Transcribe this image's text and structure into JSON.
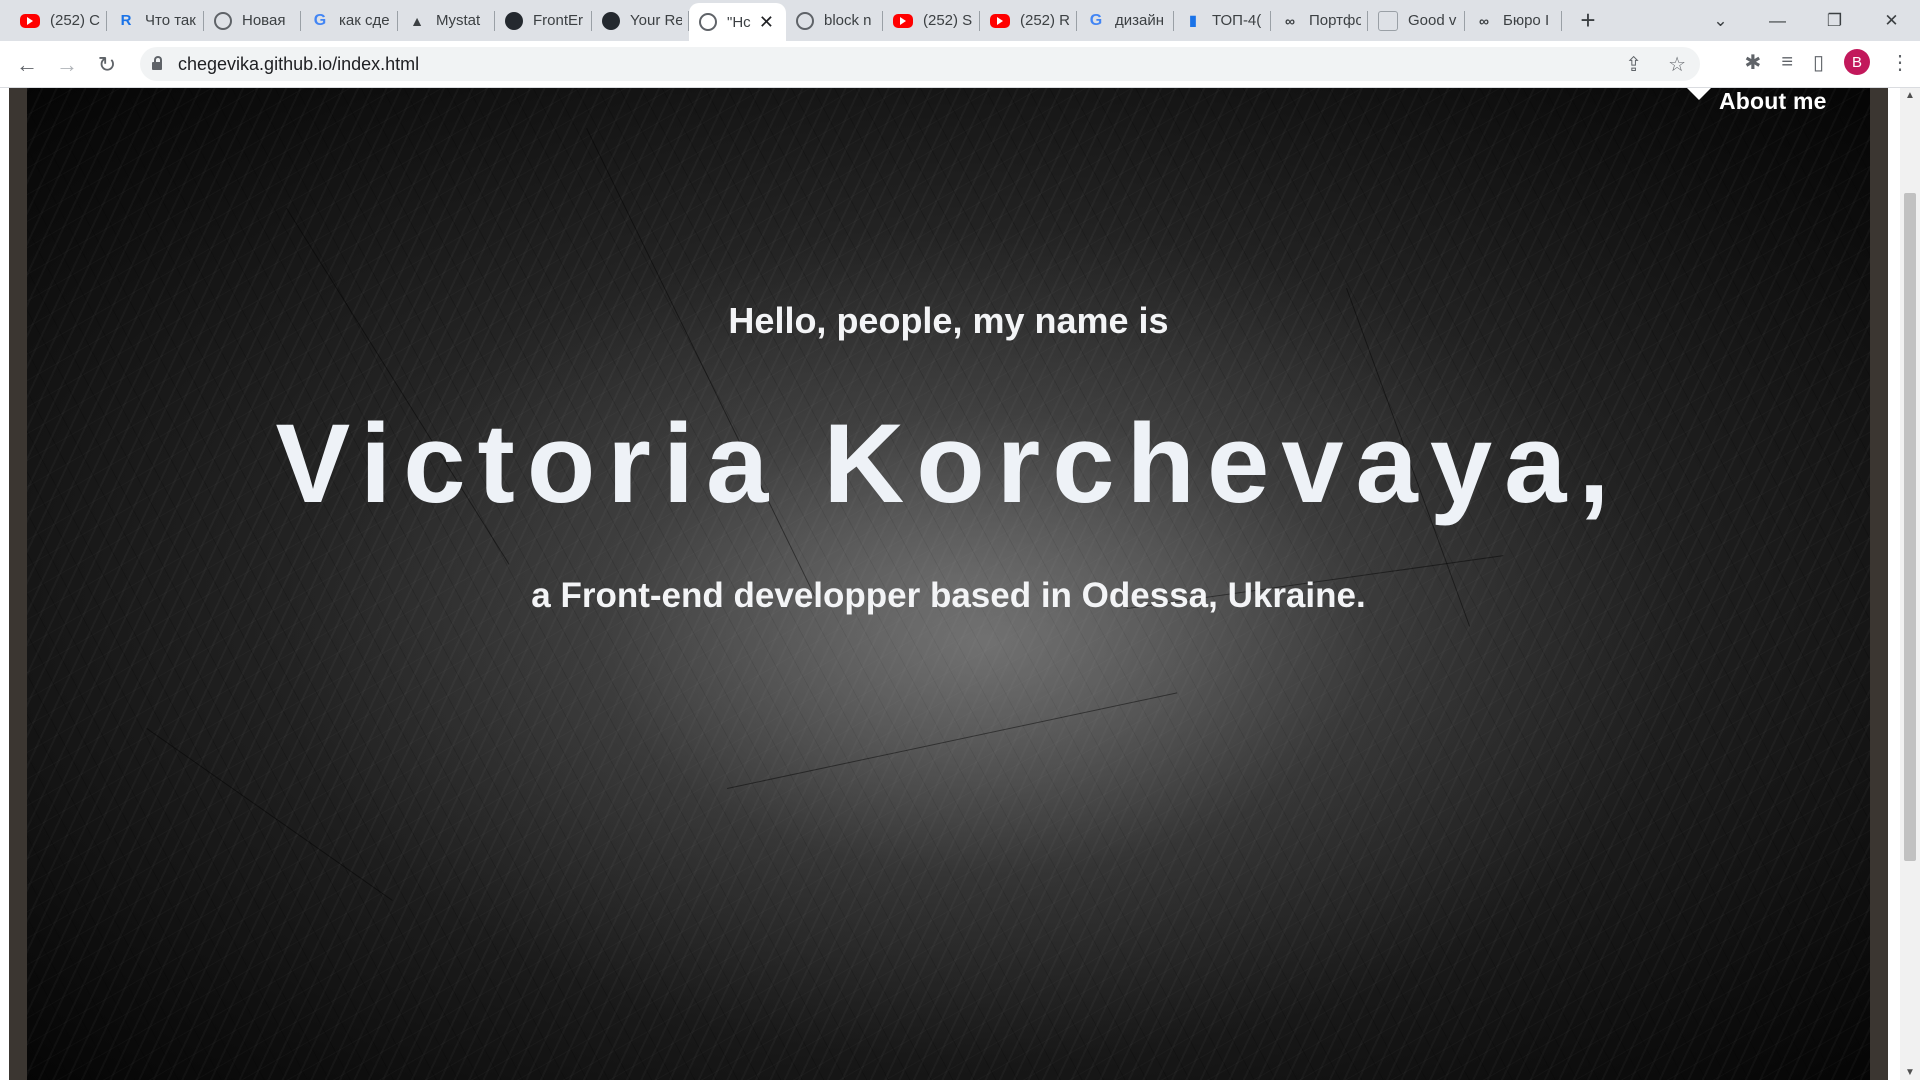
{
  "browser": {
    "tabs": [
      {
        "label": "(252) C",
        "icon": "youtube-icon"
      },
      {
        "label": "Что так",
        "icon": "r-logo-icon"
      },
      {
        "label": "Новая",
        "icon": "chrome-icon"
      },
      {
        "label": "как сде",
        "icon": "google-icon"
      },
      {
        "label": "Mystat",
        "icon": "graduation-cap-icon"
      },
      {
        "label": "FrontEr",
        "icon": "github-icon"
      },
      {
        "label": "Your Re",
        "icon": "github-icon"
      },
      {
        "label": "\"Hc",
        "icon": "globe-icon",
        "active": true
      },
      {
        "label": "block n",
        "icon": "globe-icon"
      },
      {
        "label": "(252) S",
        "icon": "youtube-icon"
      },
      {
        "label": "(252) R",
        "icon": "youtube-icon"
      },
      {
        "label": "дизайн",
        "icon": "google-icon"
      },
      {
        "label": "ТОП-4(",
        "icon": "bar-chart-icon"
      },
      {
        "label": "Портфо",
        "icon": "infinity-icon"
      },
      {
        "label": "Good v",
        "icon": "website-icon"
      },
      {
        "label": "Бюро I",
        "icon": "ox-icon"
      }
    ],
    "new_tab": "+",
    "url": "chegevika.github.io/index.html",
    "profile_initial": "B"
  },
  "page": {
    "nav_about": "About me",
    "greeting": "Hello, people, my name is",
    "name": "Victoria Korchevaya,",
    "tagline": "a Front-end developper based in Odessa, Ukraine."
  }
}
